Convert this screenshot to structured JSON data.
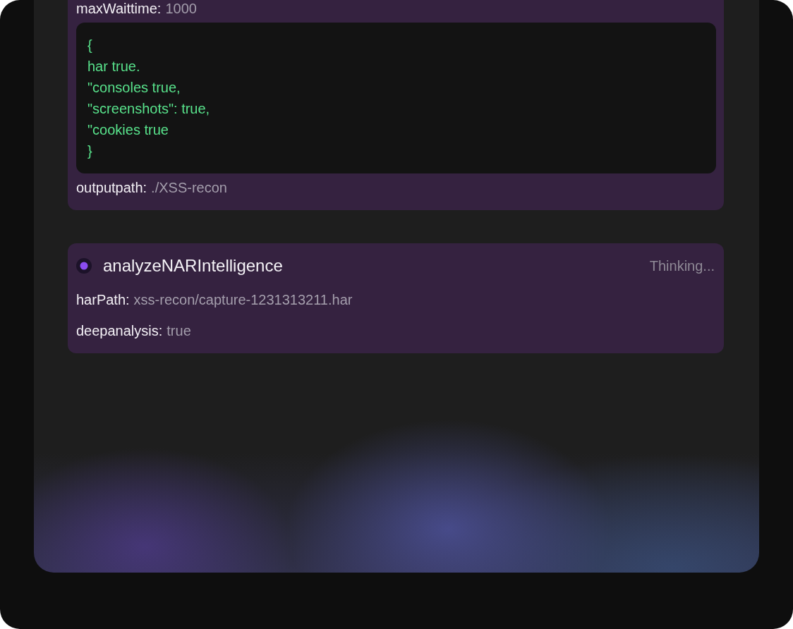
{
  "cards": [
    {
      "rows": [
        {
          "kind": "field",
          "label": "maxWaittime:",
          "value": "1000"
        },
        {
          "kind": "code",
          "lines": [
            "{",
            "har true.",
            "\"consoles true,",
            "\"screenshots\": true,",
            "\"cookies true",
            "}"
          ]
        },
        {
          "kind": "field",
          "label": "outputpath:",
          "value": "./XSS-recon"
        }
      ]
    },
    {
      "title": "analyzeNARIntelligence",
      "status": "Thinking...",
      "rows": [
        {
          "kind": "field",
          "label": "harPath:",
          "value": "xss-recon/capture-1231313211.har"
        },
        {
          "kind": "field",
          "label": "deepanalysis:",
          "value": "true"
        }
      ]
    }
  ]
}
